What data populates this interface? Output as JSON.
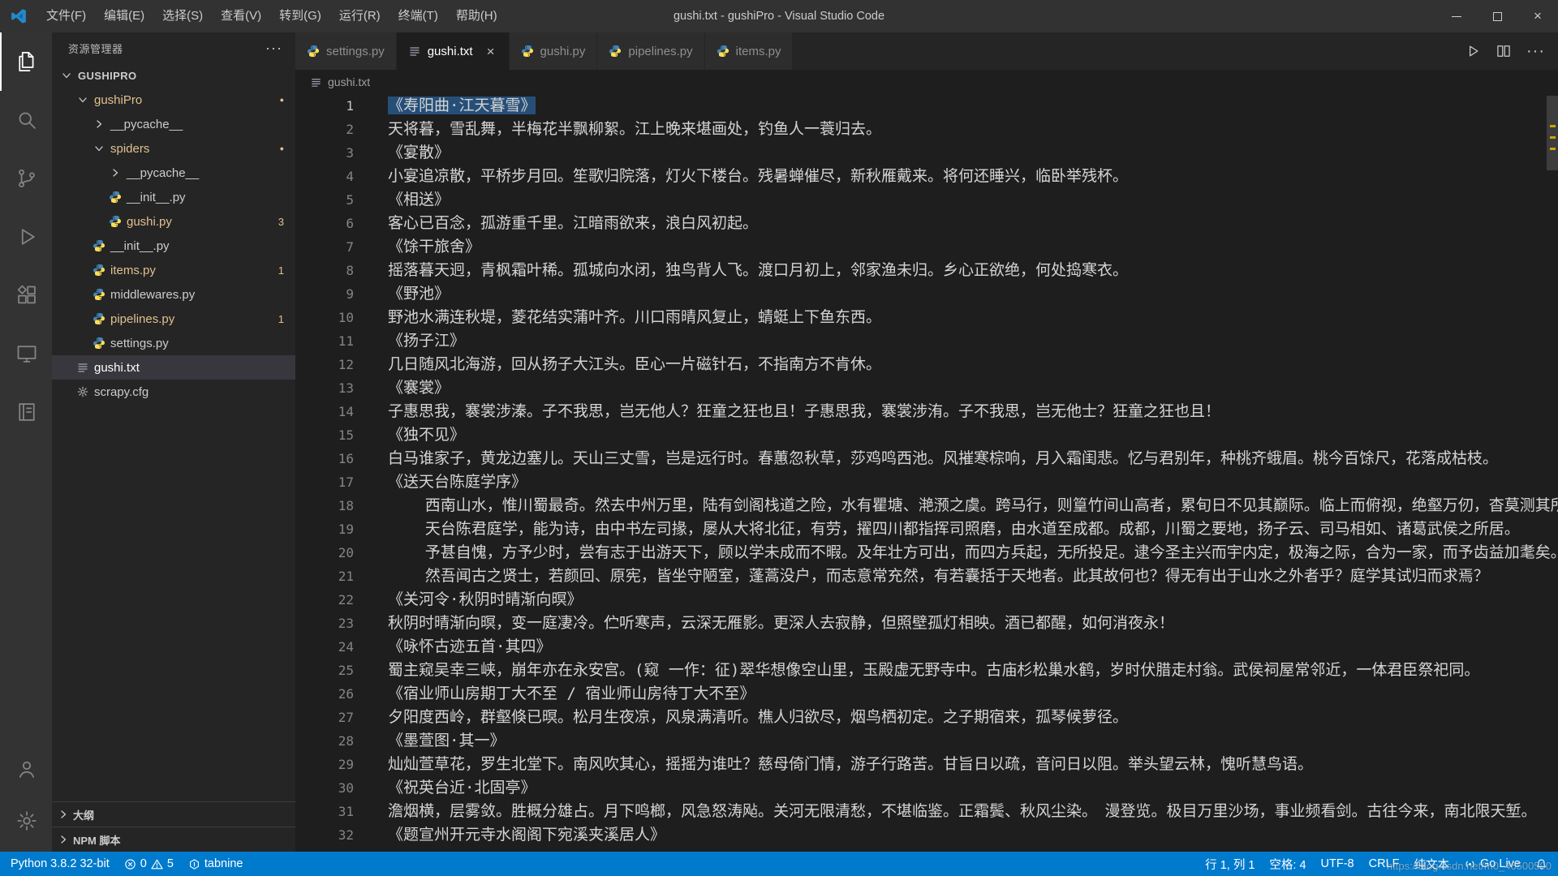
{
  "titlebar": {
    "title": "gushi.txt - gushiPro - Visual Studio Code",
    "menus": [
      {
        "id": "file",
        "label": "文件(F)"
      },
      {
        "id": "edit",
        "label": "编辑(E)"
      },
      {
        "id": "selection",
        "label": "选择(S)"
      },
      {
        "id": "view",
        "label": "查看(V)"
      },
      {
        "id": "go",
        "label": "转到(G)"
      },
      {
        "id": "run",
        "label": "运行(R)"
      },
      {
        "id": "terminal",
        "label": "终端(T)"
      },
      {
        "id": "help",
        "label": "帮助(H)"
      }
    ]
  },
  "activity_bar": {
    "top": [
      {
        "id": "explorer",
        "active": true
      },
      {
        "id": "search",
        "active": false
      },
      {
        "id": "source-control",
        "active": false
      },
      {
        "id": "run-debug",
        "active": false
      },
      {
        "id": "extensions",
        "active": false
      },
      {
        "id": "remote-explorer",
        "active": false
      },
      {
        "id": "notebook",
        "active": false
      }
    ],
    "bottom": [
      {
        "id": "account",
        "active": false
      },
      {
        "id": "settings",
        "active": false
      }
    ]
  },
  "sidebar": {
    "header": "资源管理器",
    "tree": [
      {
        "label": "GUSHIPRO",
        "indent": 0,
        "chevron": "down",
        "root": true
      },
      {
        "label": "gushiPro",
        "indent": 1,
        "chevron": "down",
        "mod": true,
        "dot": true
      },
      {
        "label": "__pycache__",
        "indent": 2,
        "chevron": "right"
      },
      {
        "label": "spiders",
        "indent": 2,
        "chevron": "down",
        "mod": true,
        "dot": true
      },
      {
        "label": "__pycache__",
        "indent": 3,
        "chevron": "right"
      },
      {
        "label": "__init__.py",
        "indent": 3,
        "icon": "python"
      },
      {
        "label": "gushi.py",
        "indent": 3,
        "icon": "python",
        "mod": true,
        "badge": "3"
      },
      {
        "label": "__init__.py",
        "indent": 2,
        "icon": "python"
      },
      {
        "label": "items.py",
        "indent": 2,
        "icon": "python",
        "mod": true,
        "badge": "1"
      },
      {
        "label": "middlewares.py",
        "indent": 2,
        "icon": "python"
      },
      {
        "label": "pipelines.py",
        "indent": 2,
        "icon": "python",
        "mod": true,
        "badge": "1"
      },
      {
        "label": "settings.py",
        "indent": 2,
        "icon": "python"
      },
      {
        "label": "gushi.txt",
        "indent": 1,
        "icon": "textfile",
        "selected": true
      },
      {
        "label": "scrapy.cfg",
        "indent": 1,
        "icon": "gearfile"
      }
    ],
    "panels": [
      {
        "id": "outline",
        "label": "大纲"
      },
      {
        "id": "npm-scripts",
        "label": "NPM 脚本"
      }
    ]
  },
  "tabs": [
    {
      "label": "settings.py",
      "icon": "python",
      "active": false
    },
    {
      "label": "gushi.txt",
      "icon": "textfile",
      "active": true,
      "close": "×"
    },
    {
      "label": "gushi.py",
      "icon": "python",
      "active": false
    },
    {
      "label": "pipelines.py",
      "icon": "python",
      "active": false
    },
    {
      "label": "items.py",
      "icon": "python",
      "active": false
    }
  ],
  "editor_actions": [
    {
      "id": "run-file",
      "icon": "play"
    },
    {
      "id": "split-editor",
      "icon": "split"
    },
    {
      "id": "more-actions",
      "icon": "more"
    }
  ],
  "breadcrumb": {
    "file": "gushi.txt"
  },
  "editor": {
    "active_line": 1,
    "selected_line": 1,
    "lines": [
      "《寿阳曲·江天暮雪》",
      "天将暮，雪乱舞，半梅花半飘柳絮。江上晚来堪画处，钓鱼人一蓑归去。",
      "《宴散》",
      "小宴追凉散，平桥步月回。笙歌归院落，灯火下楼台。残暑蝉催尽，新秋雁戴来。将何还睡兴，临卧举残杯。",
      "《相送》",
      "客心已百念，孤游重千里。江暗雨欲来，浪白风初起。",
      "《馀干旅舍》",
      "摇落暮天迥，青枫霜叶稀。孤城向水闭，独鸟背人飞。渡口月初上，邻家渔未归。乡心正欲绝，何处捣寒衣。",
      "《野池》",
      "野池水满连秋堤，菱花结实蒲叶齐。川口雨晴风复止，蜻蜓上下鱼东西。",
      "《扬子江》",
      "几日随风北海游，回从扬子大江头。臣心一片磁针石，不指南方不肯休。",
      "《褰裳》",
      "子惠思我，褰裳涉溱。子不我思，岂无他人？狂童之狂也且！子惠思我，褰裳涉洧。子不我思，岂无他士？狂童之狂也且！",
      "《独不见》",
      "白马谁家子，黄龙边塞儿。天山三丈雪，岂是远行时。春蕙忽秋草，莎鸡鸣西池。风摧寒棕响，月入霜闺悲。忆与君别年，种桃齐蛾眉。桃今百馀尺，花落成枯枝。",
      "《送天台陈庭学序》",
      "    西南山水，惟川蜀最奇。然去中州万里，陆有剑阁栈道之险，水有瞿塘、滟滪之虞。跨马行，则篁竹间山高者，累旬日不见其巅际。临上而俯视，绝壑万仞，杳莫测其所穷。",
      "    天台陈君庭学，能为诗，由中书左司掾，屡从大将北征，有劳，擢四川都指挥司照磨，由水道至成都。成都，川蜀之要地，扬子云、司马相如、诸葛武侯之所居。",
      "    予甚自愧，方予少时，尝有志于出游天下，顾以学未成而不暇。及年壮方可出，而四方兵起，无所投足。逮今圣主兴而宇内定，极海之际，合为一家，而予齿益加耄矣。",
      "    然吾闻古之贤士，若颜回、原宪，皆坐守陋室，蓬蒿没户，而志意常充然，有若囊括于天地者。此其故何也？得无有出于山水之外者乎？庭学其试归而求焉？",
      "《关河令·秋阴时晴渐向暝》",
      "秋阴时晴渐向暝，变一庭凄冷。伫听寒声，云深无雁影。更深人去寂静，但照壁孤灯相映。酒已都醒，如何消夜永！",
      "《咏怀古迹五首·其四》",
      "蜀主窥吴幸三峡，崩年亦在永安宫。(窥 一作：征)翠华想像空山里，玉殿虚无野寺中。古庙杉松巢水鹤，岁时伏腊走村翁。武侯祠屋常邻近，一体君臣祭祀同。",
      "《宿业师山房期丁大不至 / 宿业师山房待丁大不至》",
      "夕阳度西岭，群壑倏已暝。松月生夜凉，风泉满清听。樵人归欲尽，烟鸟栖初定。之子期宿来，孤琴候萝径。",
      "《墨萱图·其一》",
      "灿灿萱草花，罗生北堂下。南风吹其心，摇摇为谁吐？慈母倚门情，游子行路苦。甘旨日以疏，音问日以阻。举头望云林，愧听慧鸟语。",
      "《祝英台近·北固亭》",
      "澹烟横，层雾敛。胜概分雄占。月下鸣榔，风急怒涛飐。关河无限清愁，不堪临鉴。正霜鬓、秋风尘染。　漫登览。极目万里沙场，事业频看剑。古往今来，南北限天堑。",
      "《题宣州开元寺水阁阁下宛溪夹溪居人》"
    ]
  },
  "statusbar": {
    "left": [
      {
        "id": "python-version",
        "label": "Python 3.8.2 32-bit"
      },
      {
        "id": "problems",
        "error_count": "0",
        "warning_count": "5"
      },
      {
        "id": "tabnine",
        "label": "tabnine",
        "icon": "tabnine"
      }
    ],
    "right": [
      {
        "id": "cursor-position",
        "label": "行 1, 列 1"
      },
      {
        "id": "indentation",
        "label": "空格: 4"
      },
      {
        "id": "encoding",
        "label": "UTF-8"
      },
      {
        "id": "eol",
        "label": "CRLF"
      },
      {
        "id": "language-mode",
        "label": "纯文本"
      },
      {
        "id": "go-live",
        "label": "Go Live",
        "icon": "broadcast"
      },
      {
        "id": "notifications",
        "label": "",
        "icon": "bell"
      }
    ],
    "accent_color": "#007acc"
  },
  "watermark": "https://blog.csdn.net/m0_46500590"
}
